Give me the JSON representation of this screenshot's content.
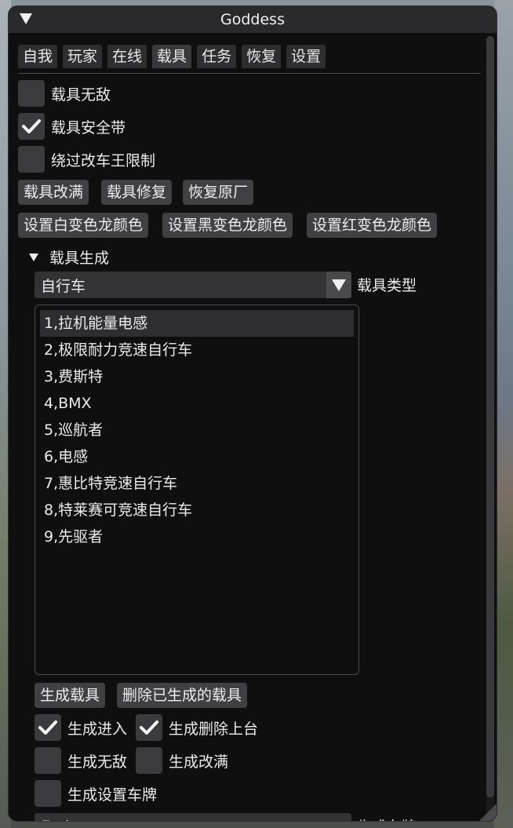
{
  "window": {
    "title": "Goddess"
  },
  "tabs": [
    {
      "label": "自我",
      "active": false
    },
    {
      "label": "玩家",
      "active": false
    },
    {
      "label": "在线",
      "active": false
    },
    {
      "label": "载具",
      "active": true
    },
    {
      "label": "任务",
      "active": false
    },
    {
      "label": "恢复",
      "active": false
    },
    {
      "label": "设置",
      "active": false
    }
  ],
  "options": {
    "invincible": {
      "label": "载具无敌",
      "checked": false
    },
    "seatbelt": {
      "label": "载具安全带",
      "checked": true
    },
    "bypass_lsc": {
      "label": "绕过改车王限制",
      "checked": false
    }
  },
  "buttons": {
    "max_upgrade": "载具改满",
    "repair": "载具修复",
    "restore_factory": "恢复原厂",
    "white_chameleon": "设置白变色龙颜色",
    "black_chameleon": "设置黑变色龙颜色",
    "red_chameleon": "设置红变色龙颜色"
  },
  "spawn": {
    "section_label": "载具生成",
    "type_value": "自行车",
    "type_label": "载具类型",
    "vehicles": [
      {
        "label": "1,拉机能量电感",
        "selected": true
      },
      {
        "label": "2,极限耐力竞速自行车",
        "selected": false
      },
      {
        "label": "3,费斯特",
        "selected": false
      },
      {
        "label": "4,BMX",
        "selected": false
      },
      {
        "label": "5,巡航者",
        "selected": false
      },
      {
        "label": "6,电感",
        "selected": false
      },
      {
        "label": "7,惠比特竞速自行车",
        "selected": false
      },
      {
        "label": "8,特莱赛可竞速自行车",
        "selected": false
      },
      {
        "label": "9,先驱者",
        "selected": false
      }
    ],
    "spawn_button": "生成载具",
    "delete_button": "删除已生成的载具",
    "spawn_enter": {
      "label": "生成进入",
      "checked": true
    },
    "spawn_delete_prev": {
      "label": "生成删除上台",
      "checked": true
    },
    "spawn_invincible": {
      "label": "生成无敌",
      "checked": false
    },
    "spawn_max": {
      "label": "生成改满",
      "checked": false
    },
    "spawn_plate": {
      "label": "生成设置车牌",
      "checked": false
    },
    "plate_value": "Erebus",
    "plate_label": "生成车牌"
  }
}
